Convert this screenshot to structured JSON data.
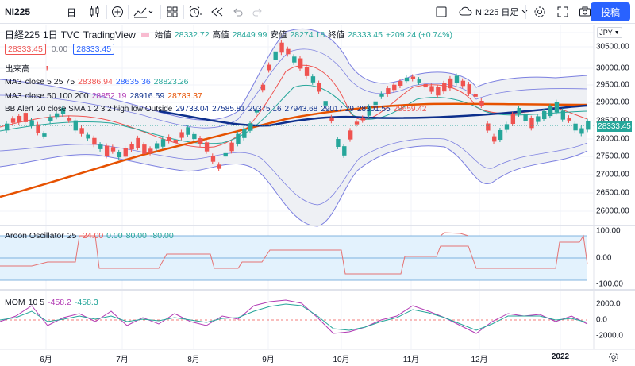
{
  "toolbar": {
    "symbol": "NI225",
    "interval": "日",
    "symbol_short": "NI225 日足",
    "publish_label": "投稿",
    "icons": [
      "plus-icon",
      "candles-icon",
      "add-icon",
      "indicators-icon",
      "layout-icon",
      "alert-icon",
      "replay-icon",
      "undo-icon",
      "redo-icon",
      "layout-box-icon",
      "cloud-icon",
      "gear-icon",
      "fullscreen-icon",
      "camera-icon"
    ]
  },
  "legend": {
    "title": "日経225",
    "interval": "1日",
    "source": "TVC",
    "brand": "TradingView",
    "open_label": "始値",
    "open": "28332.72",
    "high_label": "高値",
    "high": "28449.99",
    "low_label": "安値",
    "low": "28274.18",
    "close_label": "終値",
    "close": "28333.45",
    "change": "+209.24 (+0.74%)",
    "bid": "28333.45",
    "spread": "0.00",
    "ask": "28333.45",
    "volume_label": "出来高",
    "ma_short": {
      "name": "MA3",
      "params": "close 5 25 75",
      "v1": "28386.94",
      "v2": "28635.36",
      "v3": "28823.26"
    },
    "ma_long": {
      "name": "MA3",
      "params": "close 50 100 200",
      "v1": "28852.19",
      "v2": "28916.59",
      "v3": "28783.37"
    },
    "bb": {
      "name": "BB Alert",
      "params": "20 close SMA 1 2 3 2 high low Outside",
      "v1": "29733.04",
      "v2": "27585.81",
      "v3": "29375.16",
      "v4": "27943.68",
      "v5": "29017.29",
      "v6": "28301.55",
      "v7": "28659.42"
    }
  },
  "price_axis": {
    "currency": "JPY",
    "labels": [
      "30500.00",
      "30000.00",
      "29500.00",
      "29000.00",
      "28500.00",
      "28000.00",
      "27500.00",
      "27000.00",
      "26500.00",
      "26000.00"
    ],
    "current": "28333.45"
  },
  "aroon": {
    "name": "Aroon Oscillator",
    "length": "25",
    "value": "-24.00",
    "level1": "0.00",
    "level2": "80.00",
    "level3": "-80.00",
    "axis": [
      "100.00",
      "0.00",
      "-100.00"
    ]
  },
  "mom": {
    "name": "MOM",
    "params": "10 5",
    "v1": "-458.2",
    "v2": "-458.3",
    "axis": [
      "2000.0",
      "0.0",
      "-2000.0"
    ]
  },
  "time_axis": [
    "6月",
    "7月",
    "8月",
    "9月",
    "10月",
    "11月",
    "12月",
    "2022"
  ],
  "colors": {
    "up": "#26a69a",
    "down": "#ef5350",
    "accent": "#2962ff",
    "ma_orange": "#e65100",
    "ma_navy": "#0d2f8c"
  }
}
